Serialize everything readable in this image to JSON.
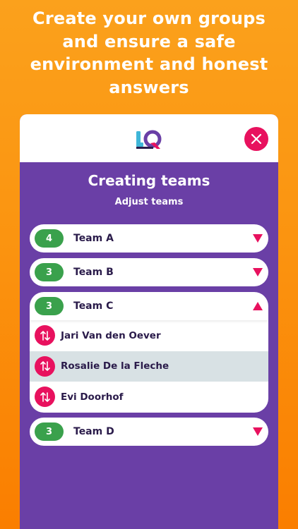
{
  "headline": {
    "line1": "Create your own groups",
    "line2": "and ensure a safe",
    "line3": "environment and honest",
    "line4": "answers"
  },
  "header": {
    "logo_text": "IQ",
    "close_icon": "close-icon"
  },
  "screen": {
    "title": "Creating teams",
    "subtitle": "Adjust teams"
  },
  "teams": [
    {
      "count": "4",
      "name": "Team A",
      "expanded": false
    },
    {
      "count": "3",
      "name": "Team B",
      "expanded": false
    },
    {
      "count": "3",
      "name": "Team C",
      "expanded": true,
      "members": [
        {
          "name": "Jari Van den Oever",
          "selected": false
        },
        {
          "name": "Rosalie De la Fleche",
          "selected": true
        },
        {
          "name": "Evi Doorhof",
          "selected": false
        }
      ]
    },
    {
      "count": "3",
      "name": "Team D",
      "expanded": false
    }
  ],
  "colors": {
    "background_top": "#fba11c",
    "background_bottom": "#fa7e00",
    "card_purple": "#6a3fa6",
    "accent_pink": "#e8115e",
    "count_green": "#3aa14c",
    "selected_row": "#d8e1e4",
    "text_dark": "#2a1b4a"
  },
  "icons": {
    "collapsed_caret": "caret-down-icon",
    "expanded_caret": "caret-up-icon",
    "member_move": "swap-vertical-icon"
  }
}
